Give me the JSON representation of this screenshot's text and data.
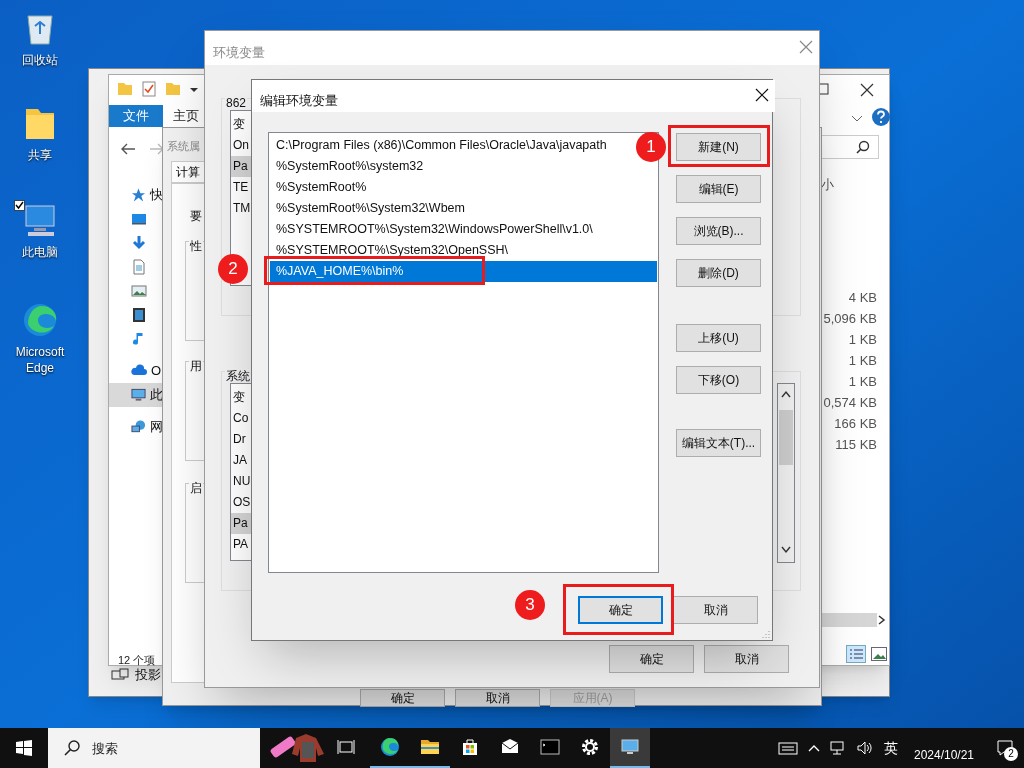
{
  "desktop_icons": [
    {
      "label": "回收站",
      "kind": "recycle"
    },
    {
      "label": "共享",
      "kind": "folder"
    },
    {
      "label": "此电脑",
      "kind": "pc",
      "checked": true
    },
    {
      "label": "Microsoft Edge",
      "kind": "edge"
    }
  ],
  "back_window": {
    "footer_label": "投影"
  },
  "explorer": {
    "ribbon_tabs": [
      {
        "label": "文件",
        "selected": true
      },
      {
        "label": "主页",
        "selected": false
      }
    ],
    "nav_items": [
      {
        "kind": "star",
        "label": "快",
        "selected": false
      },
      {
        "kind": "desktop",
        "selected": false
      },
      {
        "kind": "download",
        "selected": false
      },
      {
        "kind": "document",
        "selected": false
      },
      {
        "kind": "picture",
        "selected": false
      },
      {
        "kind": "video",
        "selected": false
      },
      {
        "kind": "music",
        "selected": false
      },
      {
        "kind": "cloud",
        "label": "O",
        "selected": false
      },
      {
        "kind": "pc",
        "label": "此",
        "selected": true
      },
      {
        "kind": "network",
        "label": "网",
        "selected": false
      }
    ],
    "column_header": "小",
    "sizes": [
      "4 KB",
      "5,096 KB",
      "1 KB",
      "1 KB",
      "1 KB",
      "0,574 KB",
      "166 KB",
      "115 KB"
    ],
    "status": "12 个项"
  },
  "system_properties": {
    "title": "系统属",
    "tab": "计算",
    "text": "要",
    "groups": [
      "性",
      "用",
      "启"
    ],
    "buttons": [
      {
        "label": "确定",
        "disabled": false
      },
      {
        "label": "取消",
        "disabled": false
      },
      {
        "label": "应用(A)",
        "disabled": true
      }
    ]
  },
  "env_window": {
    "title": "环境变量",
    "user_group": "862",
    "user_rows": [
      {
        "text": "变",
        "selected": false
      },
      {
        "text": "On",
        "selected": false
      },
      {
        "text": "Pa",
        "selected": true
      },
      {
        "text": "TE",
        "selected": false
      },
      {
        "text": "TM",
        "selected": false
      }
    ],
    "system_group": "系统",
    "system_rows": [
      {
        "text": "变",
        "selected": false
      },
      {
        "text": "Co",
        "selected": false
      },
      {
        "text": "Dr",
        "selected": false
      },
      {
        "text": "JA",
        "selected": false
      },
      {
        "text": "NU",
        "selected": false
      },
      {
        "text": "OS",
        "selected": false
      },
      {
        "text": "Pa",
        "selected": true
      },
      {
        "text": "PA",
        "selected": false
      }
    ],
    "buttons": [
      "确定",
      "取消"
    ]
  },
  "edit_dialog": {
    "title": "编辑环境变量",
    "paths": [
      {
        "text": "C:\\Program Files (x86)\\Common Files\\Oracle\\Java\\javapath",
        "selected": false
      },
      {
        "text": "%SystemRoot%\\system32",
        "selected": false
      },
      {
        "text": "%SystemRoot%",
        "selected": false
      },
      {
        "text": "%SystemRoot%\\System32\\Wbem",
        "selected": false
      },
      {
        "text": "%SYSTEMROOT%\\System32\\WindowsPowerShell\\v1.0\\",
        "selected": false
      },
      {
        "text": "%SYSTEMROOT%\\System32\\OpenSSH\\",
        "selected": false
      },
      {
        "text": "%JAVA_HOME%\\bin%",
        "selected": true
      }
    ],
    "side_buttons": [
      {
        "label": "新建(N)",
        "marker": "1"
      },
      {
        "label": "编辑(E)"
      },
      {
        "label": "浏览(B)..."
      },
      {
        "label": "删除(D)"
      },
      {
        "label": "上移(U)"
      },
      {
        "label": "下移(O)"
      },
      {
        "label": "编辑文本(T)..."
      }
    ],
    "bottom_buttons": [
      {
        "label": "确定",
        "default": true,
        "marker": "3"
      },
      {
        "label": "取消",
        "default": false
      }
    ],
    "path_marker": "2"
  },
  "taskbar": {
    "search_placeholder": "搜索",
    "apps": [
      {
        "kind": "taskview",
        "active": false
      },
      {
        "kind": "edge",
        "active": true
      },
      {
        "kind": "folder",
        "active": true
      },
      {
        "kind": "store",
        "active": false
      },
      {
        "kind": "mail",
        "active": false
      },
      {
        "kind": "terminal",
        "active": false
      },
      {
        "kind": "gear",
        "active": false
      },
      {
        "kind": "monitor",
        "active": true
      }
    ],
    "ime": "英",
    "date": "2024/10/21",
    "notifications": "2"
  }
}
